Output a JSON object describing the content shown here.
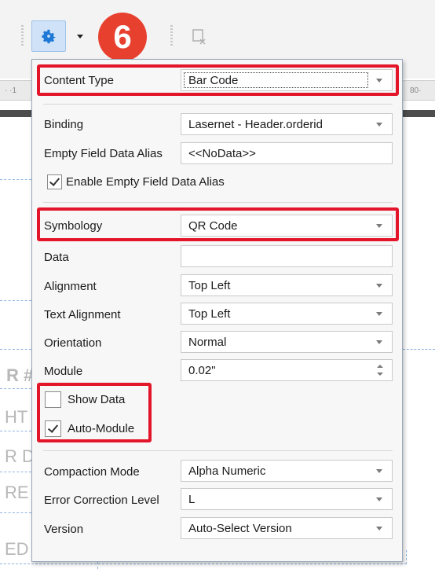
{
  "toolbar": {
    "badge_number": "6",
    "gear_icon": "gear-icon",
    "delete_icon": "delete-field-icon"
  },
  "background": {
    "ruler_left": "· ·1",
    "ruler_right": "80·",
    "text_1": "R #",
    "text_2": "HT",
    "text_3": "R D",
    "text_4": "RE",
    "text_5": "ED"
  },
  "popup": {
    "content_type": {
      "label": "Content Type",
      "value": "Bar Code"
    },
    "binding": {
      "label": "Binding",
      "value": "Lasernet - Header.orderid"
    },
    "empty_alias": {
      "label": "Empty Field Data Alias",
      "value": "<<NoData>>"
    },
    "enable_empty_alias": {
      "label": "Enable Empty Field Data Alias",
      "checked": true
    },
    "symbology": {
      "label": "Symbology",
      "value": "QR Code"
    },
    "data": {
      "label": "Data",
      "value": ""
    },
    "alignment": {
      "label": "Alignment",
      "value": "Top Left"
    },
    "text_alignment": {
      "label": "Text Alignment",
      "value": "Top Left"
    },
    "orientation": {
      "label": "Orientation",
      "value": "Normal"
    },
    "module": {
      "label": "Module",
      "value": "0.02\""
    },
    "show_data": {
      "label": "Show Data",
      "checked": false
    },
    "auto_module": {
      "label": "Auto-Module",
      "checked": true
    },
    "compaction_mode": {
      "label": "Compaction Mode",
      "value": "Alpha Numeric"
    },
    "error_correction": {
      "label": "Error Correction Level",
      "value": "L"
    },
    "version": {
      "label": "Version",
      "value": "Auto-Select Version"
    }
  },
  "colors": {
    "highlight": "#e3152a",
    "badge": "#e8402f",
    "gear": "#1e78d6"
  }
}
